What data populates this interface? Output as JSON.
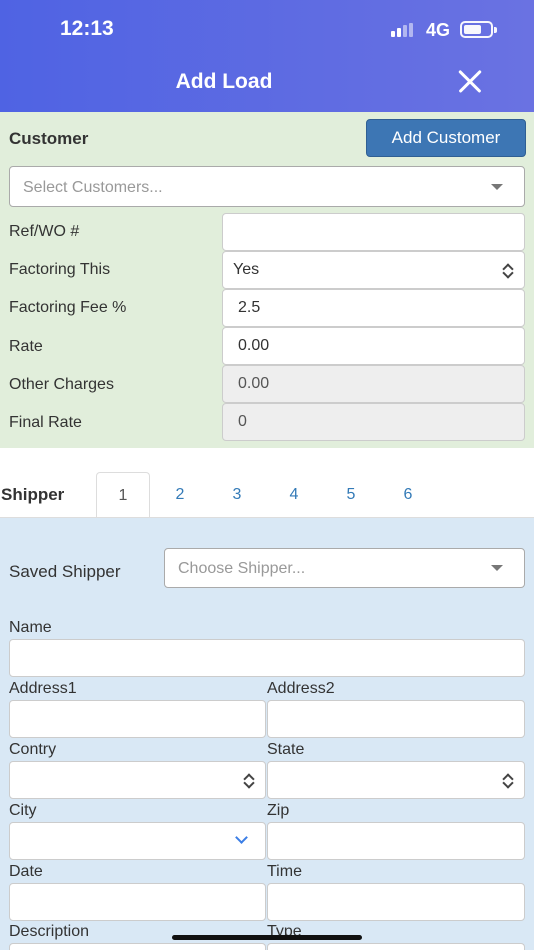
{
  "status_bar": {
    "time": "12:13",
    "network": "4G"
  },
  "header": {
    "title": "Add Load"
  },
  "customer": {
    "label": "Customer",
    "add_button": "Add Customer",
    "select_placeholder": "Select Customers...",
    "rows": [
      {
        "label": "Ref/WO #",
        "value": ""
      },
      {
        "label": "Factoring This",
        "value": "Yes"
      },
      {
        "label": "Factoring Fee %",
        "value": "2.5"
      },
      {
        "label": "Rate",
        "value": "0.00"
      },
      {
        "label": "Other Charges",
        "value": "0.00"
      },
      {
        "label": "Final Rate",
        "value": "0"
      }
    ]
  },
  "tabs": {
    "title": "Shipper",
    "items": [
      "1",
      "2",
      "3",
      "4",
      "5",
      "6"
    ],
    "active": "1"
  },
  "shipper": {
    "saved_label": "Saved Shipper",
    "saved_placeholder": "Choose Shipper...",
    "fields": {
      "name": "Name",
      "address1": "Address1",
      "address2": "Address2",
      "country": "Contry",
      "state": "State",
      "city": "City",
      "zip": "Zip",
      "date": "Date",
      "time": "Time",
      "description": "Description",
      "type": "Type"
    }
  }
}
